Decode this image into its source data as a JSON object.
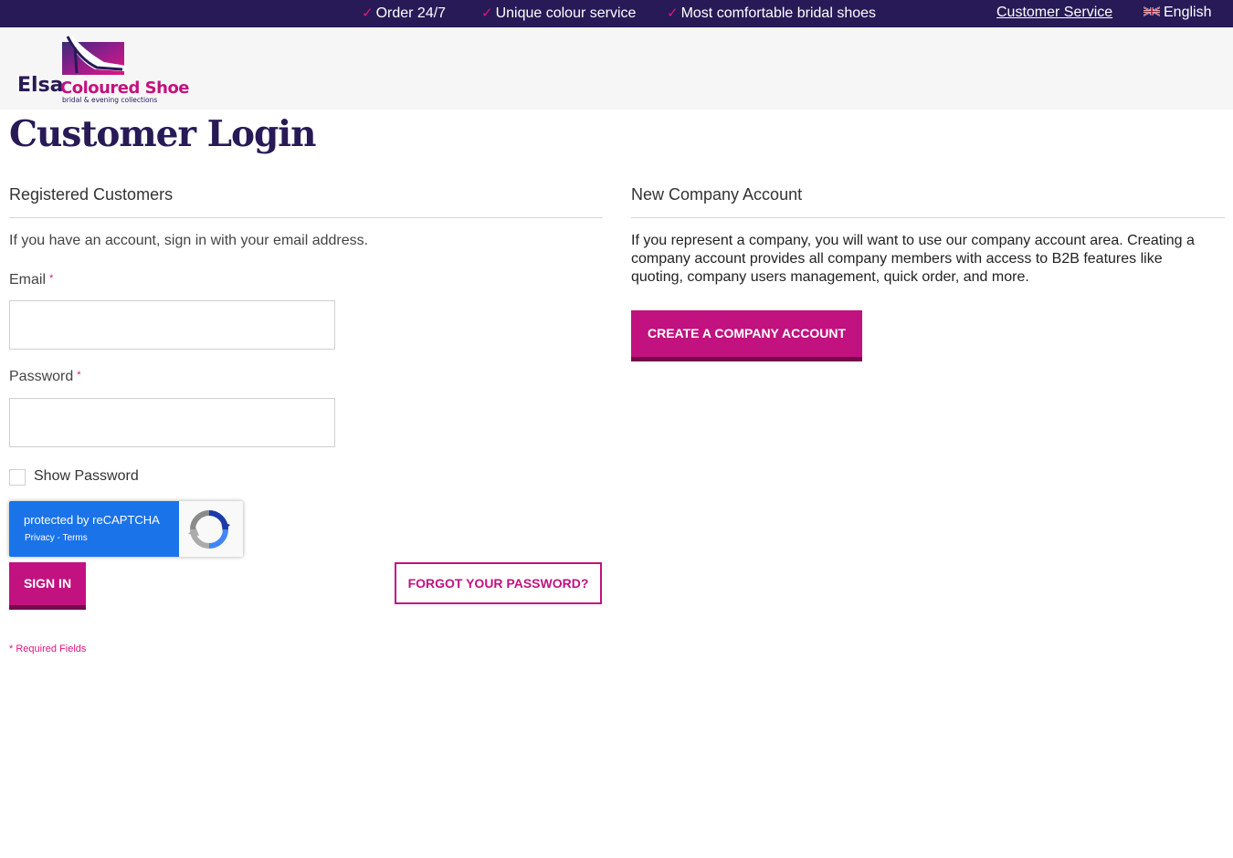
{
  "topbar": {
    "usps": [
      "Order 24/7",
      "Unique colour service",
      "Most comfortable bridal shoes"
    ],
    "check_glyph": "✓",
    "customer_service": "Customer Service",
    "language": "English",
    "language_flag_icon": "uk-flag-icon"
  },
  "brand": {
    "name_part1": "Elsa",
    "name_part2": "Coloured Shoes",
    "tagline": "bridal & evening collections"
  },
  "page": {
    "title": "Customer Login"
  },
  "registered": {
    "title": "Registered Customers",
    "intro": "If you have an account, sign in with your email address.",
    "email_label": "Email",
    "email_value": "",
    "password_label": "Password",
    "password_value": "",
    "required_mark": "*",
    "show_password_label": "Show Password",
    "show_password_checked": false,
    "sign_in_label": "Sign In",
    "forgot_label": "FORGOT YOUR PASSWORD?",
    "required_note": "* Required Fields"
  },
  "recaptcha": {
    "title_prefix": "protected by ",
    "title_brand": "reCAPTCHA",
    "privacy": "Privacy",
    "separator": " - ",
    "terms": "Terms"
  },
  "company": {
    "title": "New Company Account",
    "description": "If you represent a company, you will want to use our company account area. Creating a company account provides all company members with access to B2B features like quoting, company users management, quick order, and more.",
    "create_label": "CREATE A COMPANY ACCOUNT"
  },
  "colors": {
    "topbar_bg": "#271a56",
    "accent": "#c1127f",
    "accent_dark": "#730b4d",
    "title_color": "#271a56",
    "recaptcha_blue": "#1a73e8"
  }
}
